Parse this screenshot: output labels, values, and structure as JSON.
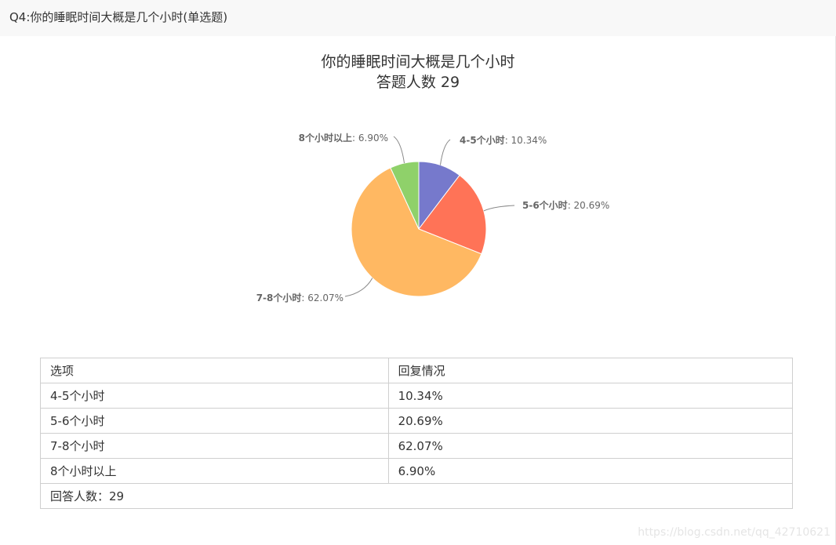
{
  "question": {
    "header": "Q4:你的睡眠时间大概是几个小时(单选题)"
  },
  "chart_data": {
    "type": "pie",
    "title": "你的睡眠时间大概是几个小时",
    "subtitle": "答题人数 29",
    "categories": [
      "4-5个小时",
      "5-6个小时",
      "7-8个小时",
      "8个小时以上"
    ],
    "values": [
      10.34,
      20.69,
      62.07,
      6.9
    ],
    "value_labels": [
      "10.34%",
      "20.69%",
      "62.07%",
      "6.90%"
    ],
    "colors": [
      "#7679cc",
      "#ff7357",
      "#ffb862",
      "#8fd16a"
    ],
    "start": "top",
    "direction": "clockwise"
  },
  "table": {
    "headers": [
      "选项",
      "回复情况"
    ],
    "rows": [
      {
        "option": "4-5个小时",
        "result": "10.34%"
      },
      {
        "option": "5-6个小时",
        "result": "20.69%"
      },
      {
        "option": "7-8个小时",
        "result": "62.07%"
      },
      {
        "option": "8个小时以上",
        "result": "6.90%"
      }
    ],
    "footer": "回答人数：29"
  },
  "watermark": "https://blog.csdn.net/qq_42710621"
}
